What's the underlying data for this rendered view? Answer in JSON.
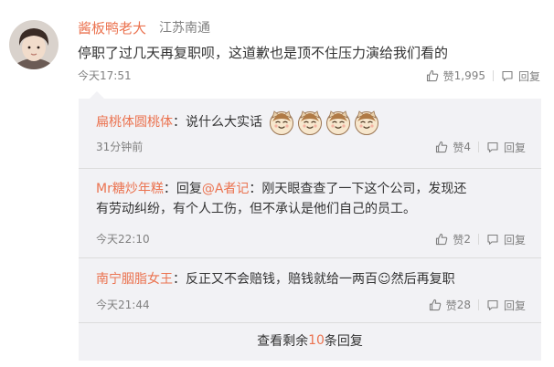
{
  "comment": {
    "author": "酱板鸭老大",
    "location": "江苏南通",
    "text": "停职了过几天再复职呗，这道歉也是顶不住压力演给我们看的",
    "time": "今天17:51",
    "like_label": "赞",
    "like_count": "1,995",
    "reply_label": "回复"
  },
  "replies": [
    {
      "author": "扁桃体圆桃体",
      "colon": "：",
      "text": "说什么大实话",
      "emoji_count": 4,
      "time": "31分钟前",
      "like_label": "赞",
      "like_count": "4",
      "reply_label": "回复"
    },
    {
      "author": "Mr糖炒年糕",
      "colon": "：",
      "reply_prefix": "回复",
      "mention": "@A者记",
      "text_line1": "：刚天眼查查了一下这个公司，发现还",
      "text_line2": "有劳动纠纷，有个人工伤，但不承认是他们自己的员工。",
      "time": "今天22:10",
      "like_label": "赞",
      "like_count": "2",
      "reply_label": "回复"
    },
    {
      "author": "南宁胭脂女王",
      "colon": "：",
      "text": "反正又不会赔钱，赔钱就给一两百☺然后再复职",
      "time": "今天21:44",
      "like_label": "赞",
      "like_count": "28",
      "reply_label": "回复"
    }
  ],
  "more": {
    "prefix": "查看剩余",
    "count": "10",
    "suffix": "条回复"
  },
  "colors": {
    "accent": "#eb7350",
    "meta": "#808080",
    "reply_bg": "#f2f2f5"
  },
  "icons": [
    "avatar",
    "thumbs-up-icon",
    "reply-icon",
    "cat-emoji-icon"
  ]
}
